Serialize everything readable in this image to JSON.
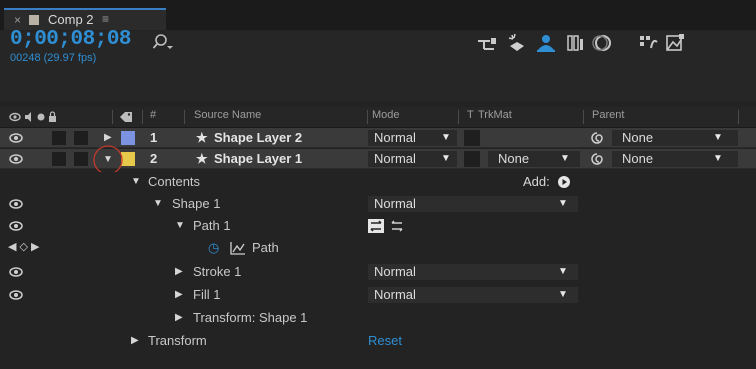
{
  "tab": {
    "close": "×",
    "title": "Comp 2",
    "menu": "≡"
  },
  "header": {
    "timecode": "0;00;08;08",
    "frames": "00248 (29.97 fps)",
    "search_icon": "search-icon"
  },
  "columns": {
    "num": "#",
    "source_name": "Source Name",
    "mode": "Mode",
    "t": "T",
    "trkmat": "TrkMat",
    "parent": "Parent"
  },
  "layers": [
    {
      "number": "1",
      "name": "Shape Layer 2",
      "label_color": "#7b93e0",
      "mode": "Normal",
      "trkmat": "",
      "parent": "None"
    },
    {
      "number": "2",
      "name": "Shape Layer 1",
      "label_color": "#e6c84b",
      "mode": "Normal",
      "trkmat": "None",
      "parent": "None"
    }
  ],
  "properties": {
    "contents": "Contents",
    "add": "Add:",
    "shape1": "Shape 1",
    "shape1_mode": "Normal",
    "path1": "Path 1",
    "path": "Path",
    "stroke1": "Stroke 1",
    "stroke1_mode": "Normal",
    "fill1": "Fill 1",
    "fill1_mode": "Normal",
    "transform_shape1": "Transform: Shape 1",
    "transform": "Transform",
    "reset": "Reset"
  },
  "colors": {
    "accent_blue": "#2f8fd4",
    "annotation_circle": "#c0392b"
  }
}
